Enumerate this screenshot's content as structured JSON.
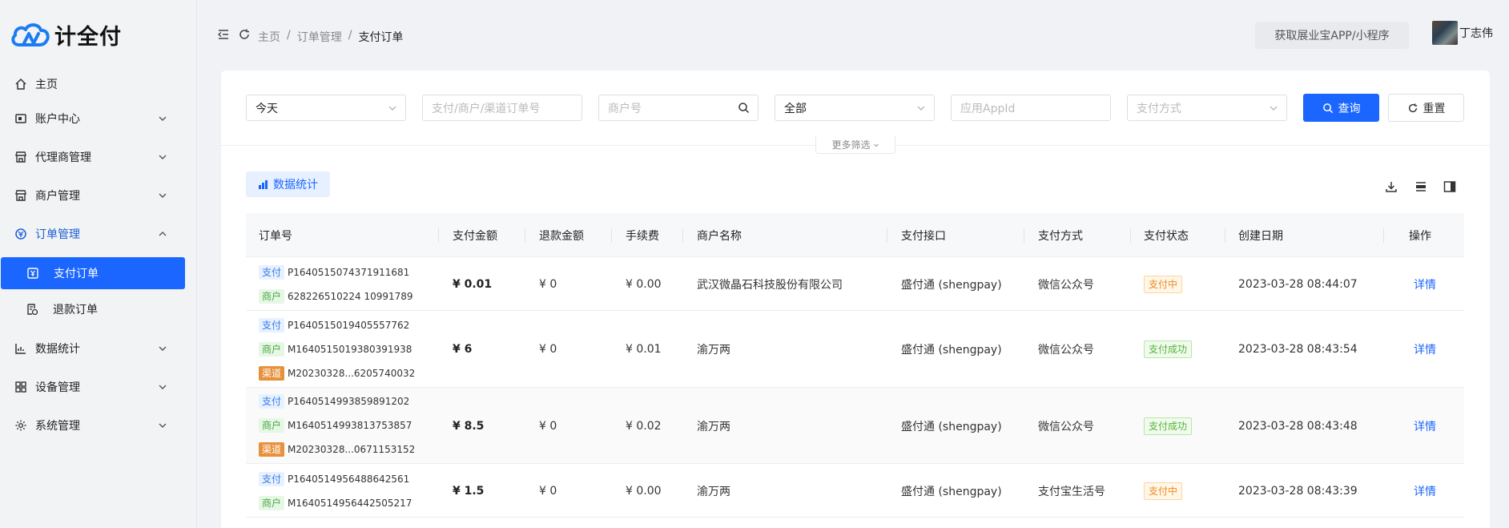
{
  "brand": {
    "name": "计全付"
  },
  "sidebar": {
    "items": [
      {
        "label": "主页",
        "icon": "home-icon"
      },
      {
        "label": "账户中心",
        "icon": "account-icon"
      },
      {
        "label": "代理商管理",
        "icon": "store-icon"
      },
      {
        "label": "商户管理",
        "icon": "shop-icon"
      },
      {
        "label": "订单管理",
        "icon": "order-icon"
      },
      {
        "label": "数据统计",
        "icon": "chart-icon"
      },
      {
        "label": "设备管理",
        "icon": "grid-icon"
      },
      {
        "label": "系统管理",
        "icon": "gear-icon"
      }
    ],
    "sub_items": [
      {
        "label": "支付订单",
        "icon": "yuan-doc-icon"
      },
      {
        "label": "退款订单",
        "icon": "refund-doc-icon"
      }
    ]
  },
  "header": {
    "breadcrumb": [
      "主页",
      "/",
      "订单管理",
      "/",
      "支付订单"
    ],
    "app_button": "获取展业宝APP/小程序",
    "user_name": "丁志伟"
  },
  "filters": {
    "date": "今天",
    "order_no_placeholder": "支付/商户/渠道订单号",
    "mch_no_placeholder": "商户号",
    "type": "全部",
    "app_id_placeholder": "应用AppId",
    "pay_way_placeholder": "支付方式",
    "query_label": "查询",
    "reset_label": "重置",
    "more_label": "更多筛选"
  },
  "stats_label": "数据统计",
  "table": {
    "columns": [
      "订单号",
      "支付金额",
      "退款金额",
      "手续费",
      "商户名称",
      "支付接口",
      "支付方式",
      "支付状态",
      "创建日期",
      "操作"
    ],
    "tag_labels": {
      "pay": "支付",
      "mch": "商户",
      "chn": "渠道"
    },
    "rows": [
      {
        "pay_no": "P1640515074371911681",
        "mch_no": "628226510224 10991789",
        "chn_no": "",
        "amount": "¥ 0.01",
        "refund": "¥ 0",
        "fee": "¥ 0.00",
        "merchant": "武汉微晶石科技股份有限公司",
        "interface": "盛付通 (shengpay)",
        "way": "微信公众号",
        "status": "支付中",
        "status_type": "ing",
        "created": "2023-03-28 08:44:07",
        "action": "详情"
      },
      {
        "pay_no": "P1640515019405557762",
        "mch_no": "M1640515019380391938",
        "chn_no": "M20230328...6205740032",
        "amount": "¥ 6",
        "refund": "¥ 0",
        "fee": "¥ 0.01",
        "merchant": "渝万两",
        "interface": "盛付通 (shengpay)",
        "way": "微信公众号",
        "status": "支付成功",
        "status_type": "ok",
        "created": "2023-03-28 08:43:54",
        "action": "详情"
      },
      {
        "pay_no": "P1640514993859891202",
        "mch_no": "M1640514993813753857",
        "chn_no": "M20230328...0671153152",
        "amount": "¥ 8.5",
        "refund": "¥ 0",
        "fee": "¥ 0.02",
        "merchant": "渝万两",
        "interface": "盛付通 (shengpay)",
        "way": "微信公众号",
        "status": "支付成功",
        "status_type": "ok",
        "created": "2023-03-28 08:43:48",
        "action": "详情"
      },
      {
        "pay_no": "P1640514956488642561",
        "mch_no": "M1640514956442505217",
        "chn_no": "",
        "amount": "¥ 1.5",
        "refund": "¥ 0",
        "fee": "¥ 0.00",
        "merchant": "渝万两",
        "interface": "盛付通 (shengpay)",
        "way": "支付宝生活号",
        "status": "支付中",
        "status_type": "ing",
        "created": "2023-03-28 08:43:39",
        "action": "详情"
      }
    ]
  },
  "colors": {
    "primary": "#1b66ff",
    "pending": "#f08a24",
    "success": "#52b43a"
  }
}
